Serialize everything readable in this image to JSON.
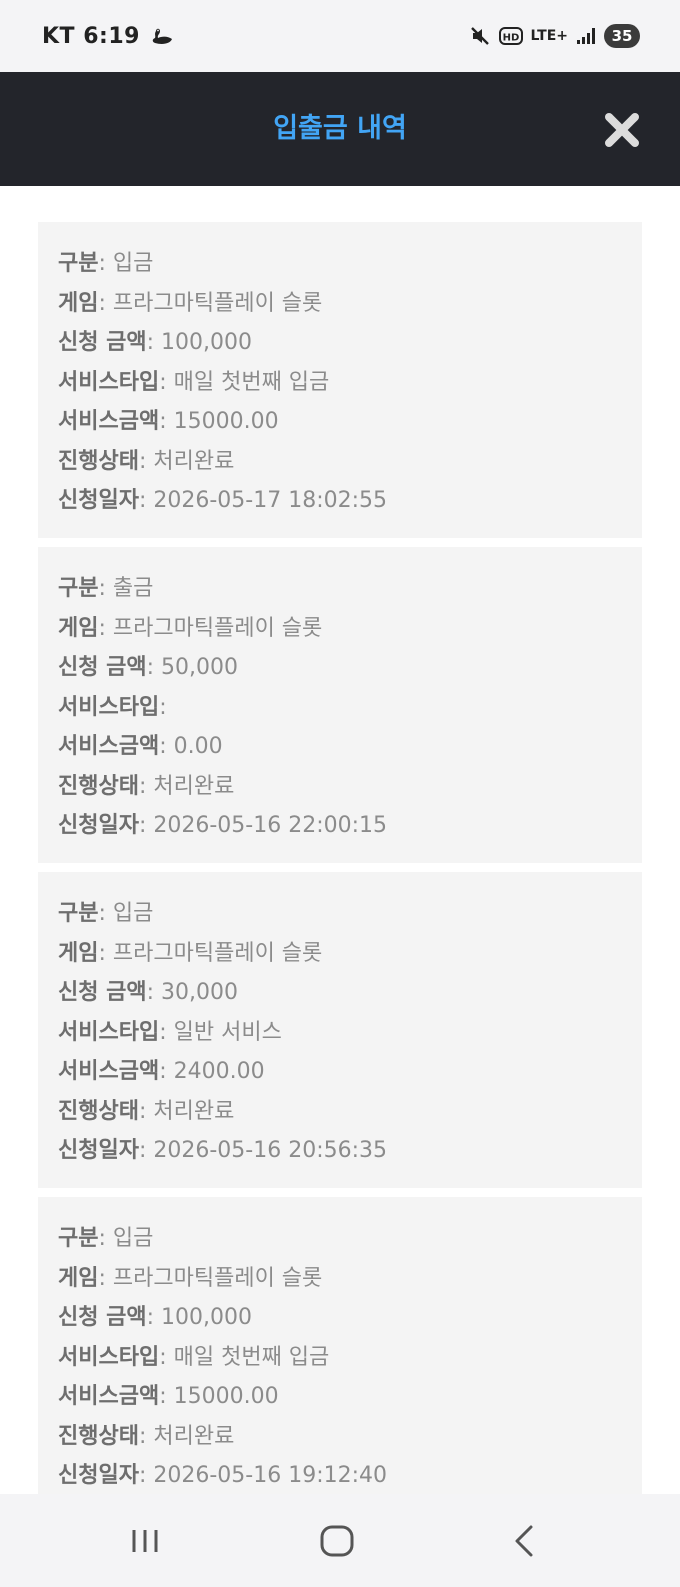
{
  "status": {
    "carrier_time": "KT 6:19",
    "network": "LTE+",
    "battery": "35",
    "icons": [
      "swan-icon",
      "mute-icon",
      "hd-icon",
      "lte-icon",
      "signal-icon",
      "battery-icon"
    ]
  },
  "header": {
    "title": "입출금 내역",
    "close_icon": "close-icon"
  },
  "labels": {
    "type": "구분",
    "game": "게임",
    "amount": "신청 금액",
    "service_type": "서비스타입",
    "service_amount": "서비스금액",
    "status": "진행상태",
    "date": "신청일자",
    "separator": ": "
  },
  "transactions": [
    {
      "type": "입금",
      "game": "프라그마틱플레이 슬롯",
      "amount": "100,000",
      "service_type": "매일 첫번째 입금",
      "service_amount": "15000.00",
      "status": "처리완료",
      "date": "2026-05-17 18:02:55"
    },
    {
      "type": "출금",
      "game": "프라그마틱플레이 슬롯",
      "amount": "50,000",
      "service_type": "",
      "service_amount": "0.00",
      "status": "처리완료",
      "date": "2026-05-16 22:00:15"
    },
    {
      "type": "입금",
      "game": "프라그마틱플레이 슬롯",
      "amount": "30,000",
      "service_type": "일반 서비스",
      "service_amount": "2400.00",
      "status": "처리완료",
      "date": "2026-05-16 20:56:35"
    },
    {
      "type": "입금",
      "game": "프라그마틱플레이 슬롯",
      "amount": "100,000",
      "service_type": "매일 첫번째 입금",
      "service_amount": "15000.00",
      "status": "처리완료",
      "date": "2026-05-16 19:12:40"
    }
  ],
  "nav": {
    "recents_icon": "recents-icon",
    "home_icon": "home-icon",
    "back_icon": "back-icon"
  },
  "colors": {
    "header_bg": "#23252b",
    "title": "#42a5f5",
    "card_bg": "#f4f4f4"
  }
}
